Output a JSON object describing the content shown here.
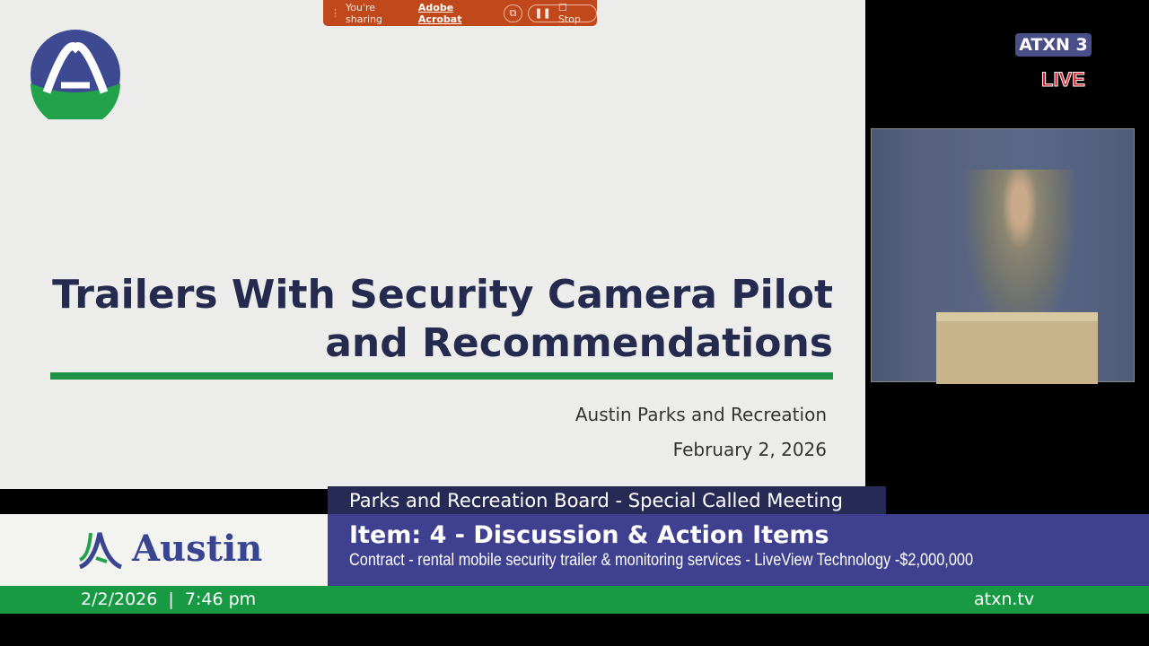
{
  "share_bar": {
    "sharing_text": "You're sharing",
    "app_name": "Adobe Acrobat",
    "stop_label": "Stop"
  },
  "slide": {
    "title_line1": "Trailers With Security Camera Pilot",
    "title_line2": "and Recommendations",
    "org": "Austin Parks and Recreation",
    "date": "February 2, 2026"
  },
  "channel": {
    "name": "ATXN 3",
    "live": "LIVE"
  },
  "lower_third": {
    "meeting": "Parks and Recreation Board - Special Called Meeting",
    "item": "Item: 4 - Discussion &  Action Items",
    "description": "Contract - rental mobile security trailer & monitoring services - LiveView Technology -$2,000,000",
    "brand": "Austin",
    "datetime": "2/2/2026  |  7:46 pm",
    "site": "atxn.tv"
  },
  "colors": {
    "navy": "#242b4f",
    "green": "#1f9447",
    "purple": "#3f4090",
    "share": "#c0481b"
  }
}
